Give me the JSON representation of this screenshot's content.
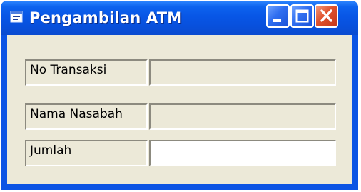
{
  "window": {
    "title": "Pengambilan ATM",
    "icon": "application-window-icon",
    "buttons": {
      "minimize": "minimize-icon",
      "maximize": "maximize-icon",
      "close": "close-icon"
    }
  },
  "form": {
    "no_transaksi": {
      "label": "No Transaksi",
      "value": ""
    },
    "nama_nasabah": {
      "label": "Nama Nasabah",
      "value": ""
    },
    "jumlah": {
      "label": "Jumlah",
      "value": ""
    }
  },
  "colors": {
    "titlebar": "#0856e6",
    "client": "#ece9d8",
    "close": "#e0512c"
  }
}
